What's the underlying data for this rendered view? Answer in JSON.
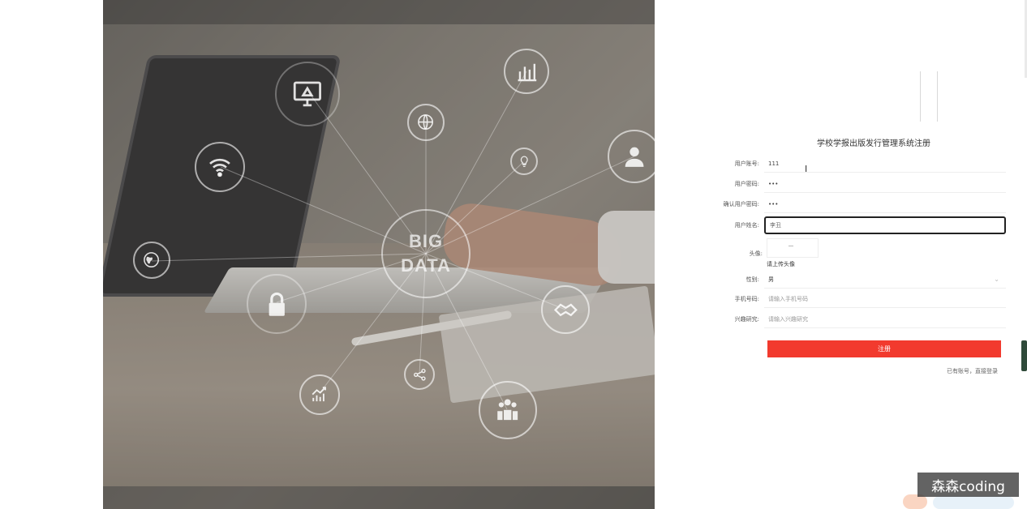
{
  "hero": {
    "big_data_line1": "BIG",
    "big_data_line2": "DATA",
    "icons": [
      "chart-icon",
      "globe-icon",
      "bulb-icon",
      "user-icon",
      "monitor-icon",
      "wifi-icon",
      "world-icon",
      "lock-icon",
      "handshake-icon",
      "share-icon",
      "growth-icon",
      "team-icon"
    ]
  },
  "form": {
    "title": "学校学报出版发行管理系统注册",
    "fields": {
      "account": {
        "label": "用户账号:",
        "value": "111"
      },
      "password": {
        "label": "用户密码:",
        "value": "•••"
      },
      "confirm": {
        "label": "确认用户密码:",
        "value": "•••"
      },
      "name": {
        "label": "用户姓名:",
        "value": "李丑"
      },
      "avatar": {
        "label": "头像:",
        "upload_text": "请上传头像"
      },
      "gender": {
        "label": "性别:",
        "value": "男"
      },
      "phone": {
        "label": "手机号码:",
        "placeholder": "请输入手机号码"
      },
      "interest": {
        "label": "兴趣研究:",
        "placeholder": "请输入兴趣研究"
      }
    },
    "submit_label": "注册",
    "login_link": "已有账号，直接登录"
  },
  "watermark": "森森coding",
  "colors": {
    "submit_bg": "#f23a2e",
    "focus_border": "#222222"
  }
}
